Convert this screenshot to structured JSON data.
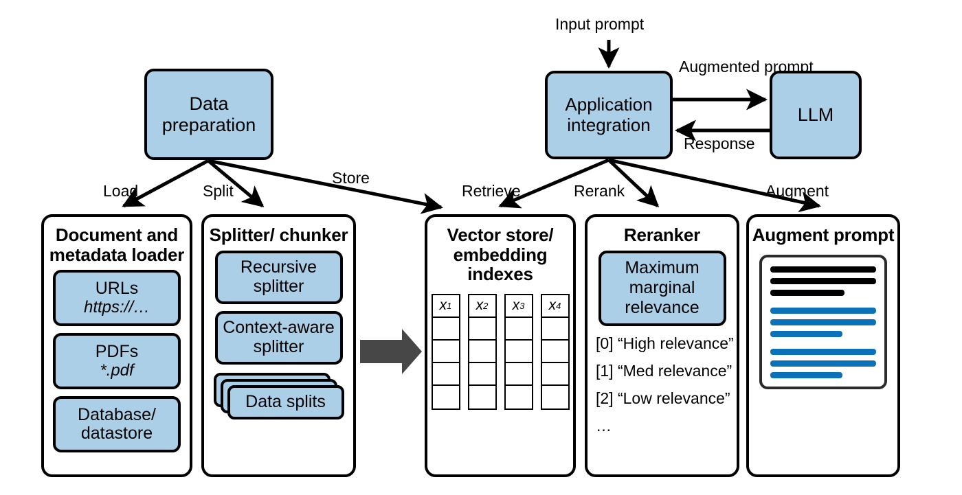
{
  "diagram": {
    "title": "RAG pipeline architecture",
    "colors": {
      "node_fill": "#aacfe7",
      "stroke": "#000000",
      "block_arrow": "#474747",
      "prompt_black": "#000000",
      "prompt_blue": "#0b72ba"
    }
  },
  "nodes": {
    "data_preparation": "Data preparation",
    "application_integration": "Application integration",
    "llm": "LLM"
  },
  "edges": {
    "input_prompt": "Input prompt",
    "augmented_prompt": "Augmented prompt",
    "response": "Response",
    "load": "Load",
    "split": "Split",
    "store": "Store",
    "retrieve": "Retrieve",
    "rerank": "Rerank",
    "augment": "Augment"
  },
  "panels": {
    "loader": {
      "title": "Document and metadata loader",
      "chips": [
        {
          "name": "URLs",
          "sub": "https://…"
        },
        {
          "name": "PDFs",
          "sub": "*.pdf"
        },
        {
          "name": "Database/ datastore",
          "sub": ""
        }
      ]
    },
    "splitter": {
      "title": "Splitter/ chunker",
      "chips": [
        {
          "name": "Recursive splitter"
        },
        {
          "name": "Context-aware splitter"
        }
      ],
      "stack_label": "Data splits"
    },
    "vector": {
      "title": "Vector store/ embedding indexes",
      "columns": [
        {
          "header": "x",
          "index": "1",
          "rows": 4
        },
        {
          "header": "x",
          "index": "2",
          "rows": 4
        },
        {
          "header": "x",
          "index": "3",
          "rows": 4
        },
        {
          "header": "x",
          "index": "4",
          "rows": 4
        }
      ]
    },
    "reranker": {
      "title": "Reranker",
      "mmr": "Maximum marginal relevance",
      "results": [
        "[0] “High relevance”",
        "[1] “Med relevance”",
        "[2] “Low relevance”",
        "…"
      ]
    },
    "augment": {
      "title": "Augment prompt",
      "prompt_lines": [
        {
          "color": "#000000",
          "width": "100%"
        },
        {
          "color": "#000000",
          "width": "100%"
        },
        {
          "color": "#000000",
          "width": "70%"
        },
        {
          "gap": true
        },
        {
          "color": "#0b72ba",
          "width": "100%"
        },
        {
          "color": "#0b72ba",
          "width": "100%"
        },
        {
          "color": "#0b72ba",
          "width": "68%"
        },
        {
          "gap": true
        },
        {
          "color": "#0b72ba",
          "width": "100%"
        },
        {
          "color": "#0b72ba",
          "width": "100%"
        },
        {
          "color": "#0b72ba",
          "width": "68%"
        }
      ]
    }
  }
}
